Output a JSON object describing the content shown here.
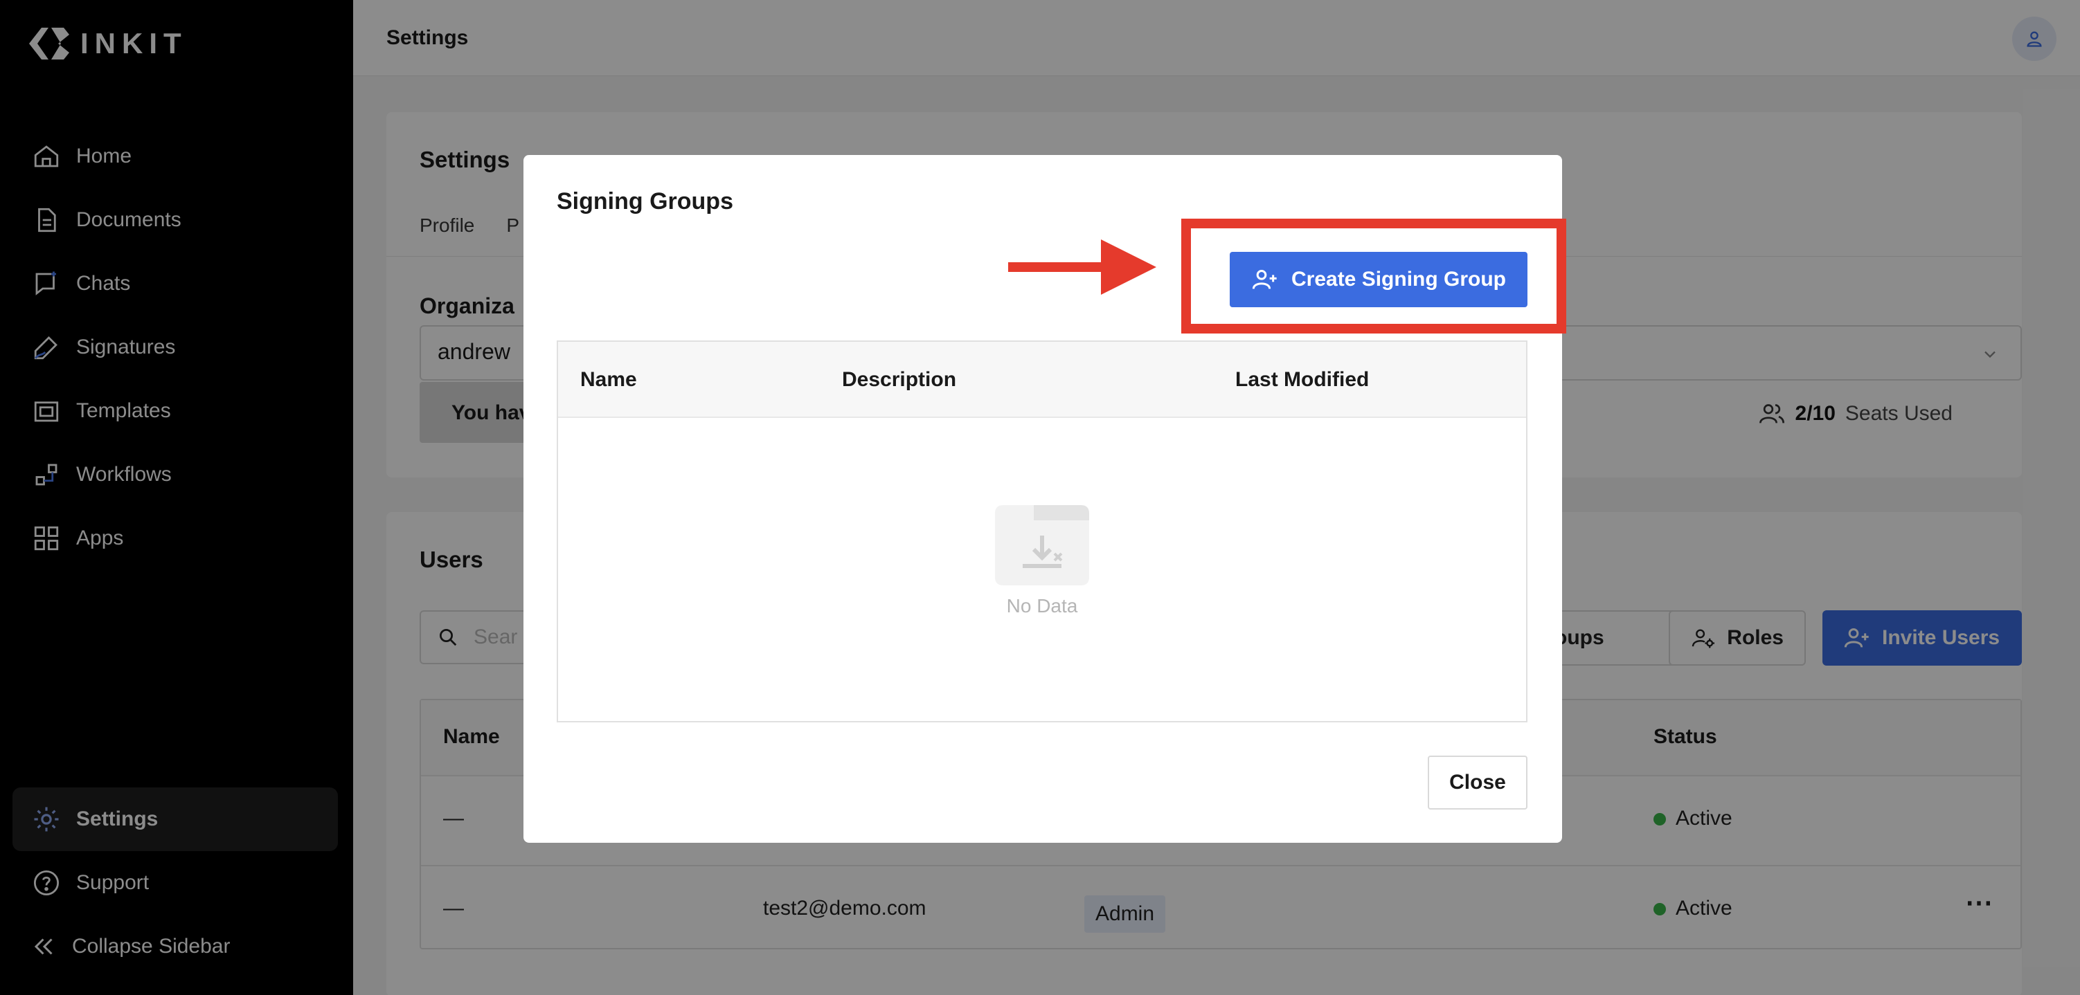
{
  "app": {
    "logo_text": "INKIT"
  },
  "sidebar": {
    "items": [
      {
        "label": "Home",
        "icon": "home-icon"
      },
      {
        "label": "Documents",
        "icon": "document-icon"
      },
      {
        "label": "Chats",
        "icon": "chat-icon"
      },
      {
        "label": "Signatures",
        "icon": "signature-icon"
      },
      {
        "label": "Templates",
        "icon": "template-icon"
      },
      {
        "label": "Workflows",
        "icon": "workflow-icon"
      },
      {
        "label": "Apps",
        "icon": "apps-icon"
      }
    ],
    "settings_label": "Settings",
    "support_label": "Support",
    "collapse_label": "Collapse Sidebar"
  },
  "header": {
    "title": "Settings"
  },
  "settings_card": {
    "title": "Settings",
    "tabs": [
      "Profile",
      "P"
    ],
    "org_label": "Organiza",
    "org_value": "andrew",
    "notice_text": "You hav",
    "seats_count": "2/10",
    "seats_label": "Seats Used"
  },
  "users_card": {
    "title": "Users",
    "search_placeholder": "Sear",
    "groups_button": "Groups",
    "roles_button": "Roles",
    "invite_button": "Invite Users",
    "columns": {
      "name": "Name",
      "status": "Status"
    },
    "rows": [
      {
        "name": "—",
        "email": "",
        "role": "",
        "status": "Active"
      },
      {
        "name": "—",
        "email": "test2@demo.com",
        "role": "Admin",
        "status": "Active"
      }
    ]
  },
  "modal": {
    "title": "Signing Groups",
    "create_button": "Create Signing Group",
    "columns": [
      "Name",
      "Description",
      "Last Modified"
    ],
    "empty_text": "No Data",
    "close_button": "Close"
  },
  "colors": {
    "accent": "#3b6ce0",
    "highlight": "#e53a2c",
    "status_active": "#39b54a"
  }
}
